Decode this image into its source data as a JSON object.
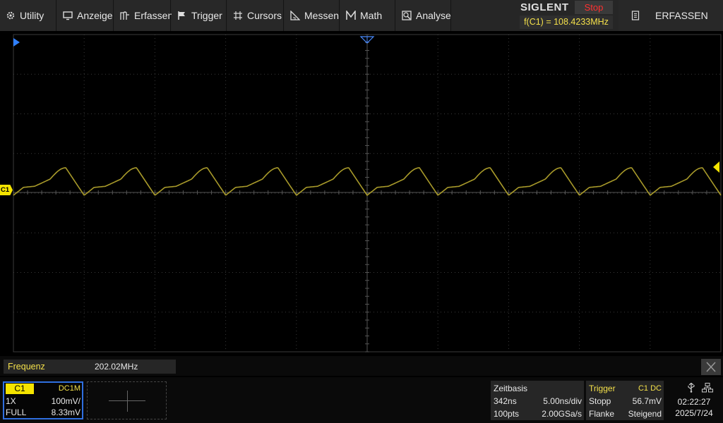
{
  "menu": {
    "items": [
      {
        "label": "Utility",
        "icon": "gear-icon"
      },
      {
        "label": "Anzeige",
        "icon": "monitor-icon"
      },
      {
        "label": "Erfassen",
        "icon": "acquire-icon"
      },
      {
        "label": "Trigger",
        "icon": "flag-icon"
      },
      {
        "label": "Cursors",
        "icon": "cursor-icon"
      },
      {
        "label": "Messen",
        "icon": "ruler-icon"
      },
      {
        "label": "Math",
        "icon": "math-icon"
      },
      {
        "label": "Analyse",
        "icon": "analysis-icon"
      }
    ]
  },
  "brand": {
    "logo": "SIGLENT",
    "run_state": "Stop",
    "frequency_readout": "f(C1) = 108.4233MHz"
  },
  "acquire_button": {
    "label": "ERFASSEN",
    "icon": "memory-icon"
  },
  "channel_marker": {
    "label": "C1"
  },
  "waveform": {
    "color": "#a89a2a",
    "periods_visible": 10,
    "grid_color": "#3a3a3a",
    "trace_color": "#a89a2a"
  },
  "measurement": {
    "label": "Frequenz",
    "value": "202.02MHz"
  },
  "channel1": {
    "name": "C1",
    "coupling": "DC1M",
    "probe": "1X",
    "scale": "100mV/",
    "bandwidth": "FULL",
    "offset": "8.33mV"
  },
  "timebase": {
    "title": "Zeitbasis",
    "delay": "342ns",
    "scale": "5.00ns/div",
    "points": "100pts",
    "sample_rate": "2.00GSa/s"
  },
  "trigger": {
    "title": "Trigger",
    "source": "C1 DC",
    "mode": "Stopp",
    "level": "56.7mV",
    "type": "Flanke",
    "slope": "Steigend"
  },
  "status": {
    "time": "02:22:27",
    "date": "2025/7/24"
  }
}
